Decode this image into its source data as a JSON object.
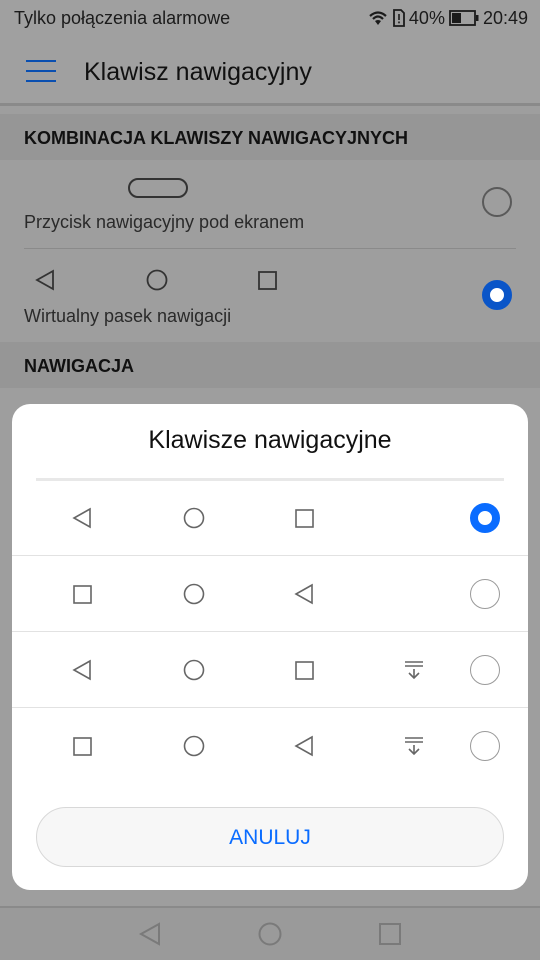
{
  "status_bar": {
    "carrier": "Tylko połączenia alarmowe",
    "battery": "40%",
    "time": "20:49",
    "icons": [
      "wifi-icon",
      "sim-alert-icon",
      "battery-icon"
    ]
  },
  "app_bar": {
    "title": "Klawisz nawigacyjny",
    "menu_icon": "hamburger-menu-icon"
  },
  "sections": [
    {
      "title": "KOMBINACJA KLAWISZY NAWIGACYJNYCH"
    },
    {
      "title": "NAWIGACJA"
    }
  ],
  "options": [
    {
      "label": "Przycisk nawigacyjny pod ekranem",
      "selected": false
    },
    {
      "label": "Wirtualny pasek nawigacji",
      "selected": true
    }
  ],
  "dialog": {
    "title": "Klawisze nawigacyjne",
    "rows": [
      {
        "icons": [
          "back-icon",
          "home-icon",
          "recents-icon"
        ],
        "selected": true
      },
      {
        "icons": [
          "recents-icon",
          "home-icon",
          "back-icon"
        ],
        "selected": false
      },
      {
        "icons": [
          "back-icon",
          "home-icon",
          "recents-icon",
          "notification-pull-icon"
        ],
        "selected": false
      },
      {
        "icons": [
          "recents-icon",
          "home-icon",
          "back-icon",
          "notification-pull-icon"
        ],
        "selected": false
      }
    ],
    "cancel_label": "ANULUJ"
  },
  "colors": {
    "accent": "#0a6cff",
    "scrim_background": "#9e9e9e"
  }
}
